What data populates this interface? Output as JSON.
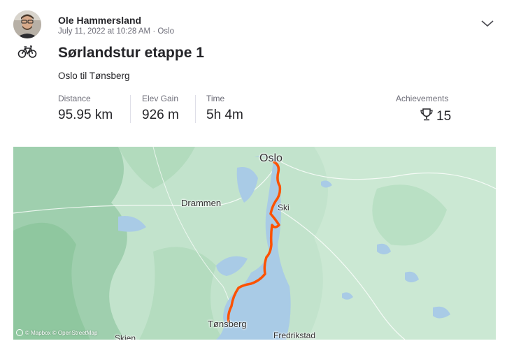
{
  "header": {
    "athlete_name": "Ole Hammersland",
    "meta": "July 11, 2022 at 10:28 AM · Oslo"
  },
  "activity": {
    "sport_icon": "bike-icon",
    "title": "Sørlandstur etappe 1",
    "description": "Oslo til Tønsberg"
  },
  "stats": [
    {
      "label": "Distance",
      "value": "95.95 km"
    },
    {
      "label": "Elev Gain",
      "value": "926 m"
    },
    {
      "label": "Time",
      "value": "5h 4m"
    }
  ],
  "achievements": {
    "label": "Achievements",
    "count": "15",
    "icon": "trophy-icon"
  },
  "map": {
    "places": {
      "oslo": "Oslo",
      "ski": "Ski",
      "drammen": "Drammen",
      "tonsberg": "Tønsberg",
      "fredrikstad": "Fredrikstad",
      "skien": "Skien"
    },
    "attribution": "© Mapbox © OpenStreetMap",
    "route_color": "#fc5200",
    "water_color": "#a9cbe6",
    "land_color": "#c2e3cc"
  }
}
